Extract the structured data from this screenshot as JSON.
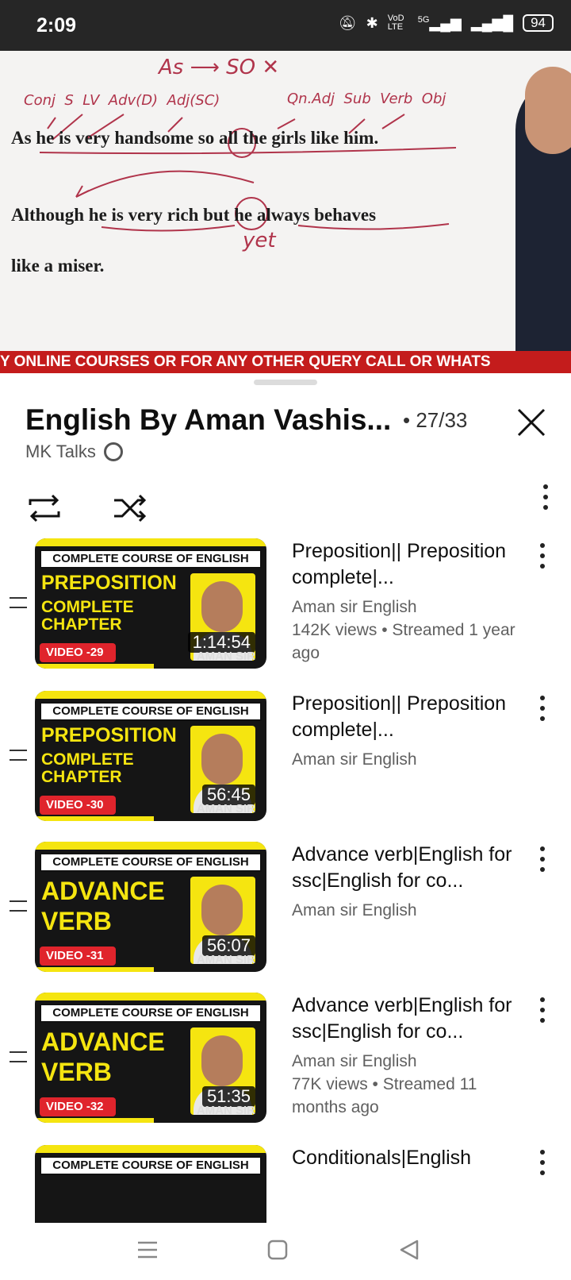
{
  "status": {
    "time": "2:09",
    "network1": "5G",
    "battery": "94",
    "volte": "VoD LTE"
  },
  "video": {
    "sentences": [
      "As he is very handsome so all the girls like him.",
      "Although he is very rich but he always behaves",
      "like a miser."
    ],
    "annotations": [
      "As ⟶ SO ✕",
      "Conj  S  LV  Adv(D)  Adj(SC)",
      "Qn.Adj  Sub  Verb  Obj",
      "yet"
    ]
  },
  "ticker": "Y ONLINE COURSES OR FOR ANY OTHER QUERY CALL OR WHATS",
  "playlist": {
    "title": "English By Aman Vashis...",
    "count": "• 27/33",
    "channel": "MK Talks"
  },
  "items": [
    {
      "banner": "COMPLETE COURSE OF ENGLISH",
      "line1": "PREPOSITION",
      "line2": "COMPLETE",
      "line3": "CHAPTER",
      "tag": "VIDEO -29",
      "duration": "1:14:54",
      "sig": "AMAN SIR",
      "title": "Preposition|| Preposition complete|...",
      "channel": "Aman sir English",
      "stats": "142K views • Streamed 1 year ago"
    },
    {
      "banner": "COMPLETE COURSE OF ENGLISH",
      "line1": "PREPOSITION",
      "line2": "COMPLETE",
      "line3": "CHAPTER",
      "tag": "VIDEO -30",
      "duration": "56:45",
      "sig": "AMAN SIR",
      "title": "Preposition|| Preposition complete|...",
      "channel": "Aman sir English",
      "stats": ""
    },
    {
      "banner": "COMPLETE COURSE OF ENGLISH",
      "line1": "ADVANCE",
      "line2": "VERB",
      "line3": "",
      "tag": "VIDEO -31",
      "duration": "56:07",
      "sig": "AMAN SIR",
      "title": "Advance verb|English for ssc|English for co...",
      "channel": "Aman sir English",
      "stats": ""
    },
    {
      "banner": "COMPLETE COURSE OF ENGLISH",
      "line1": "ADVANCE",
      "line2": "VERB",
      "line3": "",
      "tag": "VIDEO -32",
      "duration": "51:35",
      "sig": "AMAN SIR",
      "title": "Advance verb|English for ssc|English for co...",
      "channel": "Aman sir English",
      "stats": "77K views • Streamed 11 months ago"
    },
    {
      "banner": "COMPLETE COURSE OF ENGLISH",
      "line1": "",
      "line2": "",
      "line3": "",
      "tag": "",
      "duration": "",
      "sig": "",
      "title": "Conditionals|English",
      "channel": "",
      "stats": ""
    }
  ]
}
